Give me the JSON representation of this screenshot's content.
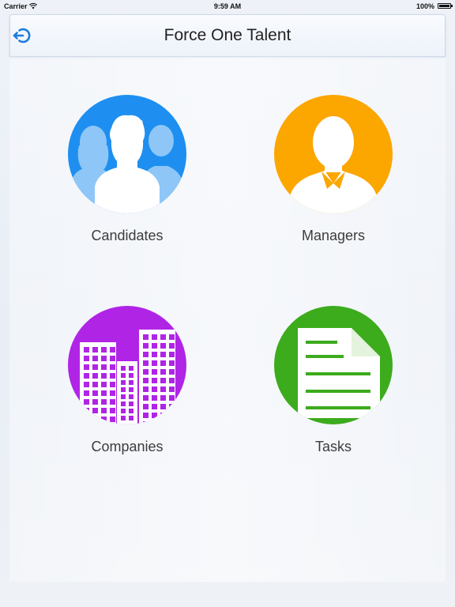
{
  "status_bar": {
    "carrier": "Carrier",
    "time": "9:59 AM",
    "battery": "100%"
  },
  "nav": {
    "title": "Force One Talent",
    "back_icon": "logout-arrow-icon"
  },
  "tiles": [
    {
      "label": "Candidates",
      "icon": "people-group-icon",
      "color": "#1e8ff0"
    },
    {
      "label": "Managers",
      "icon": "manager-person-icon",
      "color": "#fca600"
    },
    {
      "label": "Companies",
      "icon": "buildings-icon",
      "color": "#b024e6"
    },
    {
      "label": "Tasks",
      "icon": "document-icon",
      "color": "#3cab1c"
    }
  ],
  "colors": {
    "accent": "#1a7be0"
  }
}
